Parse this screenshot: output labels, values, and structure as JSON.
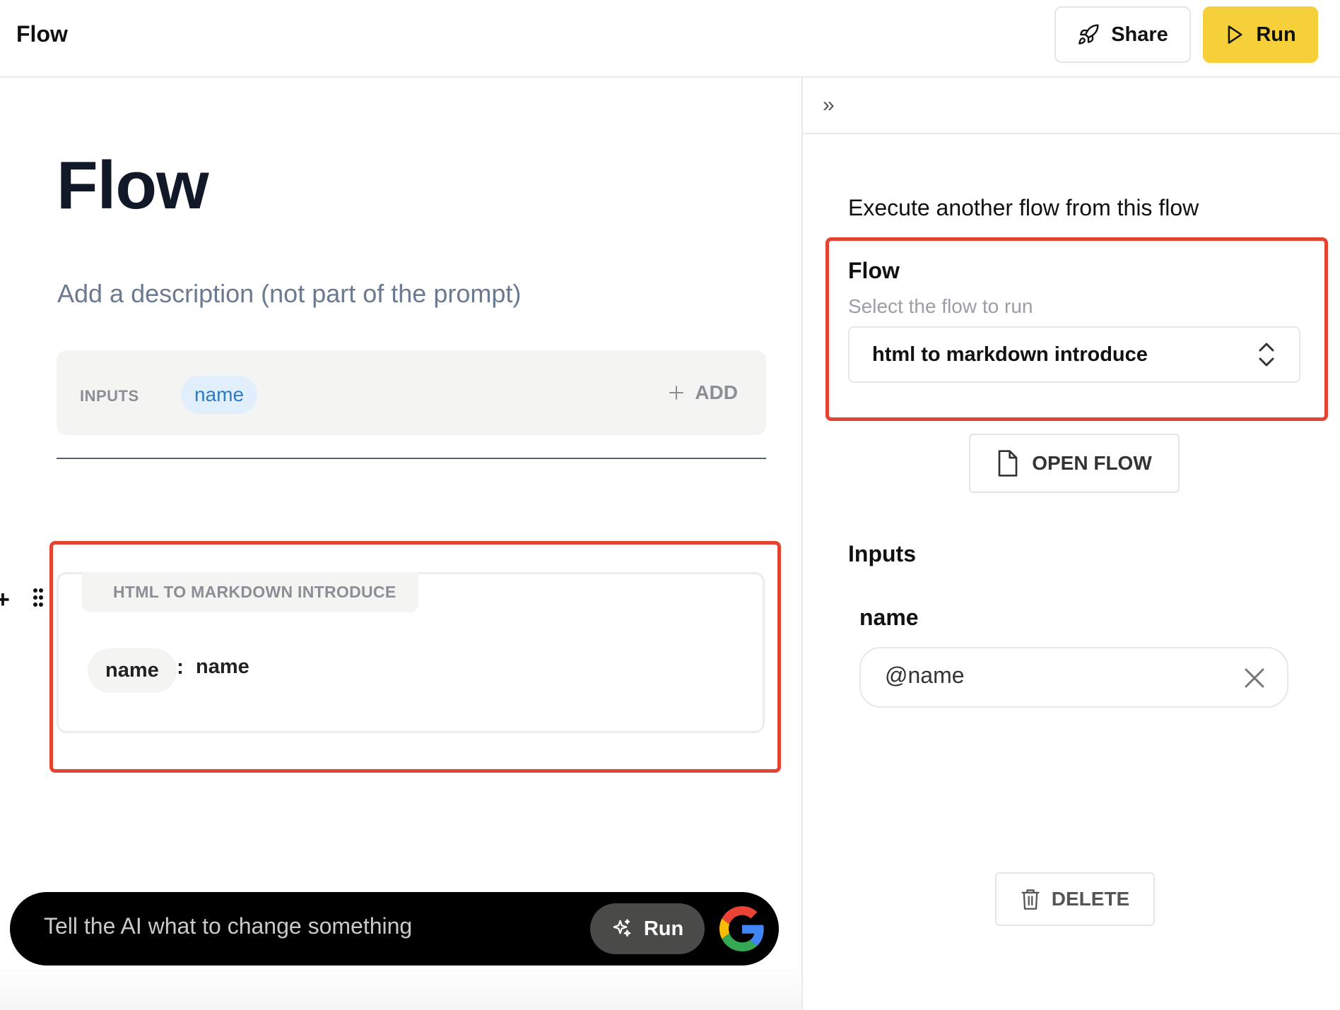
{
  "header": {
    "app_title": "Flow",
    "share_label": "Share",
    "run_label": "Run"
  },
  "editor": {
    "title": "Flow",
    "description_placeholder": "Add a description (not part of the prompt)",
    "inputs_label": "INPUTS",
    "inputs": [
      "name"
    ],
    "add_label": "ADD",
    "flow_block": {
      "flow_name": "HTML TO MARKDOWN INTRODUCE",
      "param_name": "name",
      "separator": ":",
      "param_value": "name"
    },
    "ai_bar": {
      "placeholder": "Tell the AI what to change something",
      "run_label": "Run"
    }
  },
  "sidebar": {
    "collapse_glyph": "»",
    "description": "Execute another flow from this flow",
    "flow_label": "Flow",
    "flow_hint": "Select the flow to run",
    "selected_flow": "html to markdown introduce",
    "open_flow_label": "OPEN FLOW",
    "inputs_heading": "Inputs",
    "input_name": "name",
    "input_value": "@name",
    "delete_label": "DELETE"
  },
  "colors": {
    "accent_yellow": "#f5d03b",
    "highlight_red": "#e44332",
    "chip_blue_bg": "#e0effb",
    "chip_blue_text": "#2d7bc4"
  }
}
